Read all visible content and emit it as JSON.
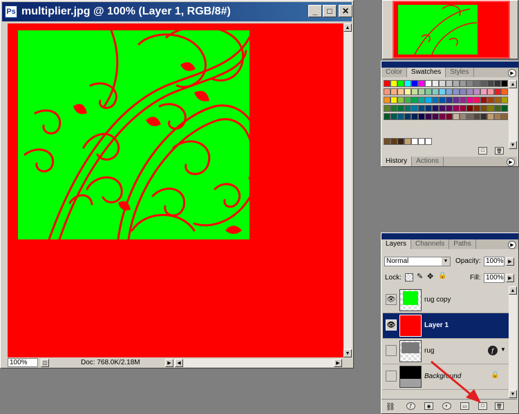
{
  "document": {
    "title": "multiplier.jpg @ 100% (Layer 1, RGB/8#)",
    "app_icon": "photoshop-doc-icon",
    "zoom": "100%",
    "doc_size": "Doc: 768.0K/2.18M",
    "canvas_bg": "#ff0000",
    "green_fill": "#00ff00",
    "buttons": {
      "minimize": "_",
      "maximize": "□",
      "close": "✕"
    }
  },
  "swatches_palette": {
    "tabs": [
      "Color",
      "Swatches",
      "Styles"
    ],
    "active_tab": "Swatches",
    "bottom_tabs": [
      "History",
      "Actions"
    ]
  },
  "layers_palette": {
    "tabs": [
      "Layers",
      "Channels",
      "Paths"
    ],
    "blend_mode": "Normal",
    "opacity_label": "Opacity:",
    "opacity_value": "100%",
    "lock_label": "Lock:",
    "fill_label": "Fill:",
    "fill_value": "100%",
    "layers": [
      {
        "name": "rug copy",
        "visible": true,
        "selected": false
      },
      {
        "name": "Layer 1",
        "visible": true,
        "selected": true
      },
      {
        "name": "rug",
        "visible": false,
        "selected": false
      },
      {
        "name": "Background",
        "visible": false,
        "selected": false
      }
    ]
  },
  "colors": {
    "titlebar": "#0a246a",
    "panel": "#d4d0c8",
    "annotation_arrow": "#e02020"
  }
}
